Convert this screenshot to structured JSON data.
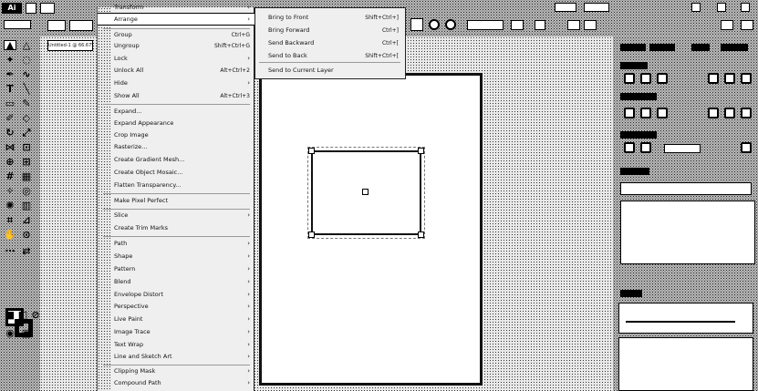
{
  "app": {
    "logo": "Ai",
    "document_tab": "Untitled-1 @ 66.67%"
  },
  "object_menu": {
    "top_partial": "Transform",
    "arrange": "Arrange",
    "group": {
      "label": "Group",
      "shortcut": "Ctrl+G"
    },
    "ungroup": {
      "label": "Ungroup",
      "shortcut": "Shift+Ctrl+G"
    },
    "lock": "Lock",
    "unlock_all": {
      "label": "Unlock All",
      "shortcut": "Alt+Ctrl+2"
    },
    "hide": "Hide",
    "show_all": {
      "label": "Show All",
      "shortcut": "Alt+Ctrl+3"
    },
    "expand": "Expand...",
    "expand_appearance": "Expand Appearance",
    "crop_image": "Crop Image",
    "rasterize": "Rasterize...",
    "create_gradient_mesh": "Create Gradient Mesh...",
    "create_object_mosaic": "Create Object Mosaic...",
    "flatten_transparency": "Flatten Transparency...",
    "make_pixel_perfect": "Make Pixel Perfect",
    "slice": "Slice",
    "create_trim_marks": "Create Trim Marks",
    "path": "Path",
    "shape": "Shape",
    "pattern": "Pattern",
    "blend": "Blend",
    "envelope_distort": "Envelope Distort",
    "perspective": "Perspective",
    "live_paint": "Live Paint",
    "image_trace": "Image Trace",
    "text_wrap": "Text Wrap",
    "line_and_sketch_art": "Line and Sketch Art",
    "clipping_mask": "Clipping Mask",
    "compound_path": "Compound Path"
  },
  "arrange_submenu": {
    "bring_to_front": {
      "label": "Bring to Front",
      "shortcut": "Shift+Ctrl+]"
    },
    "bring_forward": {
      "label": "Bring Forward",
      "shortcut": "Ctrl+]"
    },
    "send_backward": {
      "label": "Send Backward",
      "shortcut": "Ctrl+["
    },
    "send_to_back": {
      "label": "Send to Back",
      "shortcut": "Shift+Ctrl+["
    },
    "send_to_current_layer": "Send to Current Layer"
  },
  "submenu_arrow": "›"
}
